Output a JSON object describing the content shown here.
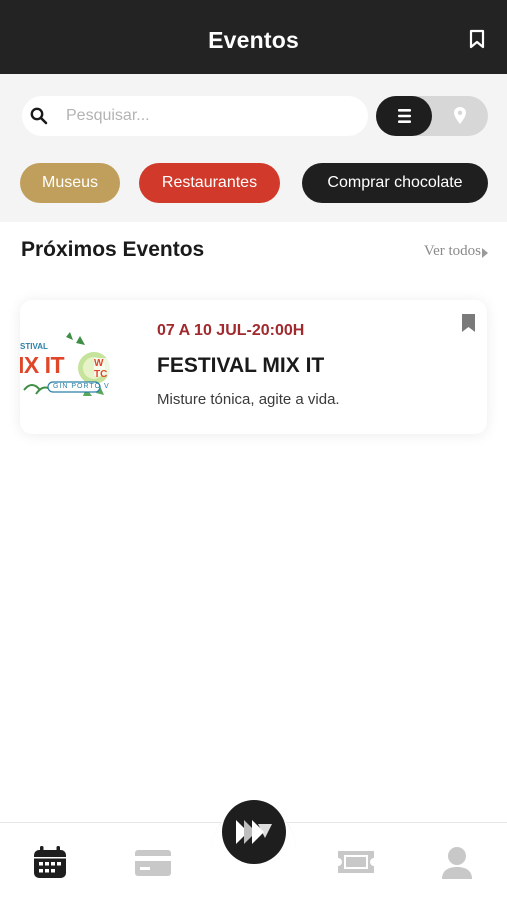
{
  "header": {
    "title": "Eventos"
  },
  "search": {
    "placeholder": "Pesquisar..."
  },
  "view_toggle": {
    "active": "list"
  },
  "filters": [
    {
      "label": "Museus",
      "color": "#c09f5c"
    },
    {
      "label": "Restaurantes",
      "color": "#d13a2b"
    },
    {
      "label": "Comprar chocolate",
      "color": "#1f1f1f"
    }
  ],
  "section": {
    "title": "Próximos Eventos",
    "see_all": "Ver todos"
  },
  "events": [
    {
      "date": "07 A 10 JUL-20:00H",
      "title": "FESTIVAL MIX IT",
      "description": "Misture tónica, agite a vida.",
      "logo_text": "IX IT"
    }
  ],
  "bottom_nav": {
    "items": [
      "calendar-icon",
      "card-icon",
      "home-logo-icon",
      "ticket-icon",
      "user-icon"
    ],
    "active": "calendar-icon"
  }
}
